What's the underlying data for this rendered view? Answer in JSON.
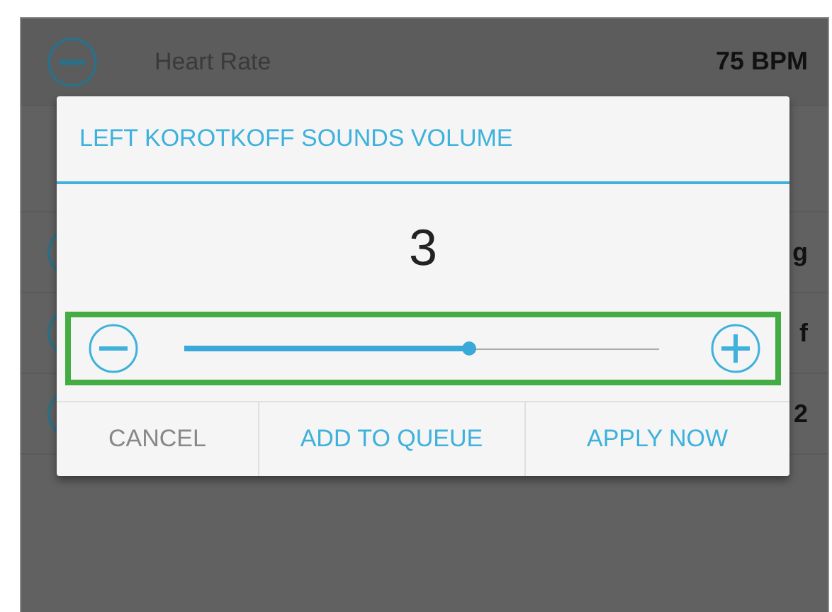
{
  "background_list": {
    "rows": [
      {
        "kind": "item",
        "label": "Heart Rate",
        "value": "75 BPM"
      },
      {
        "kind": "section"
      },
      {
        "kind": "item",
        "value": "g"
      },
      {
        "kind": "item",
        "value": "f"
      },
      {
        "kind": "item",
        "value": "2"
      }
    ]
  },
  "dialog": {
    "title": "LEFT KOROTKOFF SOUNDS VOLUME",
    "value": "3",
    "slider": {
      "level": 0.6,
      "highlighted": true
    },
    "buttons": [
      {
        "label": "CANCEL",
        "kind": "neutral"
      },
      {
        "label": "ADD TO QUEUE",
        "kind": "primary"
      },
      {
        "label": "APPLY NOW",
        "kind": "primary"
      }
    ]
  }
}
